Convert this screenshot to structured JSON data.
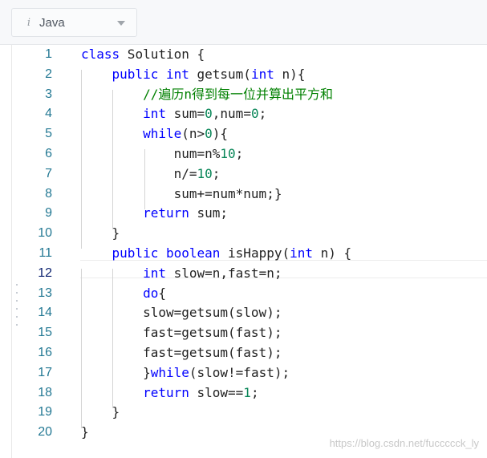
{
  "language_selector": {
    "icon": "info-italic-icon",
    "label": "Java"
  },
  "editor": {
    "current_line": 12,
    "lines": [
      {
        "n": "1",
        "tokens": [
          {
            "t": "kw",
            "v": "class"
          },
          {
            "t": "",
            "v": " Solution {"
          }
        ]
      },
      {
        "n": "2",
        "tokens": [
          {
            "t": "",
            "v": "    "
          },
          {
            "t": "kw",
            "v": "public"
          },
          {
            "t": "",
            "v": " "
          },
          {
            "t": "kw",
            "v": "int"
          },
          {
            "t": "",
            "v": " getsum("
          },
          {
            "t": "kw",
            "v": "int"
          },
          {
            "t": "",
            "v": " n){"
          }
        ]
      },
      {
        "n": "3",
        "tokens": [
          {
            "t": "",
            "v": "        "
          },
          {
            "t": "cm",
            "v": "//遍历n得到每一位并算出平方和"
          }
        ]
      },
      {
        "n": "4",
        "tokens": [
          {
            "t": "",
            "v": "        "
          },
          {
            "t": "kw",
            "v": "int"
          },
          {
            "t": "",
            "v": " sum="
          },
          {
            "t": "num",
            "v": "0"
          },
          {
            "t": "",
            "v": ",num="
          },
          {
            "t": "num",
            "v": "0"
          },
          {
            "t": "",
            "v": ";"
          }
        ]
      },
      {
        "n": "5",
        "tokens": [
          {
            "t": "",
            "v": "        "
          },
          {
            "t": "kw",
            "v": "while"
          },
          {
            "t": "",
            "v": "(n>"
          },
          {
            "t": "num",
            "v": "0"
          },
          {
            "t": "",
            "v": "){"
          }
        ]
      },
      {
        "n": "6",
        "tokens": [
          {
            "t": "",
            "v": "            num=n%"
          },
          {
            "t": "num",
            "v": "10"
          },
          {
            "t": "",
            "v": ";"
          }
        ]
      },
      {
        "n": "7",
        "tokens": [
          {
            "t": "",
            "v": "            n/="
          },
          {
            "t": "num",
            "v": "10"
          },
          {
            "t": "",
            "v": ";"
          }
        ]
      },
      {
        "n": "8",
        "tokens": [
          {
            "t": "",
            "v": "            sum+=num*num;}"
          }
        ]
      },
      {
        "n": "9",
        "tokens": [
          {
            "t": "",
            "v": "        "
          },
          {
            "t": "kw",
            "v": "return"
          },
          {
            "t": "",
            "v": " sum;"
          }
        ]
      },
      {
        "n": "10",
        "tokens": [
          {
            "t": "",
            "v": "    }"
          }
        ]
      },
      {
        "n": "11",
        "tokens": [
          {
            "t": "",
            "v": "    "
          },
          {
            "t": "kw",
            "v": "public"
          },
          {
            "t": "",
            "v": " "
          },
          {
            "t": "kw",
            "v": "boolean"
          },
          {
            "t": "",
            "v": " isHappy("
          },
          {
            "t": "kw",
            "v": "int"
          },
          {
            "t": "",
            "v": " n) {"
          }
        ]
      },
      {
        "n": "12",
        "tokens": [
          {
            "t": "",
            "v": "        "
          },
          {
            "t": "kw",
            "v": "int"
          },
          {
            "t": "",
            "v": " slow=n,fast=n;"
          }
        ]
      },
      {
        "n": "13",
        "tokens": [
          {
            "t": "",
            "v": "        "
          },
          {
            "t": "kw",
            "v": "do"
          },
          {
            "t": "",
            "v": "{"
          }
        ]
      },
      {
        "n": "14",
        "tokens": [
          {
            "t": "",
            "v": "        slow=getsum(slow);"
          }
        ]
      },
      {
        "n": "15",
        "tokens": [
          {
            "t": "",
            "v": "        fast=getsum(fast);"
          }
        ]
      },
      {
        "n": "16",
        "tokens": [
          {
            "t": "",
            "v": "        fast=getsum(fast);"
          }
        ]
      },
      {
        "n": "17",
        "tokens": [
          {
            "t": "",
            "v": "        }"
          },
          {
            "t": "kw",
            "v": "while"
          },
          {
            "t": "",
            "v": "(slow!=fast);"
          }
        ]
      },
      {
        "n": "18",
        "tokens": [
          {
            "t": "",
            "v": "        "
          },
          {
            "t": "kw",
            "v": "return"
          },
          {
            "t": "",
            "v": " slow=="
          },
          {
            "t": "num",
            "v": "1"
          },
          {
            "t": "",
            "v": ";"
          }
        ]
      },
      {
        "n": "19",
        "tokens": [
          {
            "t": "",
            "v": "    }"
          }
        ]
      },
      {
        "n": "20",
        "tokens": [
          {
            "t": "",
            "v": "}"
          }
        ]
      }
    ]
  },
  "watermark": "https://blog.csdn.net/fuccccck_ly",
  "colors": {
    "keyword": "#0000ff",
    "number": "#098658",
    "comment": "#008000",
    "line_number": "#237893"
  }
}
